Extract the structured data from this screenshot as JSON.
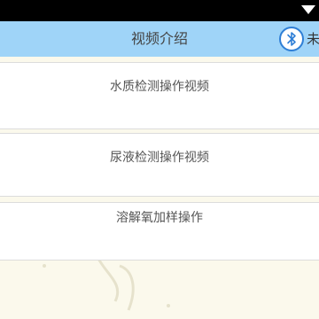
{
  "header": {
    "title": "视频介绍",
    "bluetooth_icon": "bluetooth-icon",
    "bluetooth_status": "未"
  },
  "videos": [
    {
      "label": "水质检测操作视频"
    },
    {
      "label": "尿液检测操作视频"
    },
    {
      "label": "溶解氧加样操作"
    }
  ],
  "colors": {
    "header_bg": "#9fd4f8",
    "page_bg": "#fbf9ec",
    "bluetooth_ring": "#2f7fd6"
  }
}
